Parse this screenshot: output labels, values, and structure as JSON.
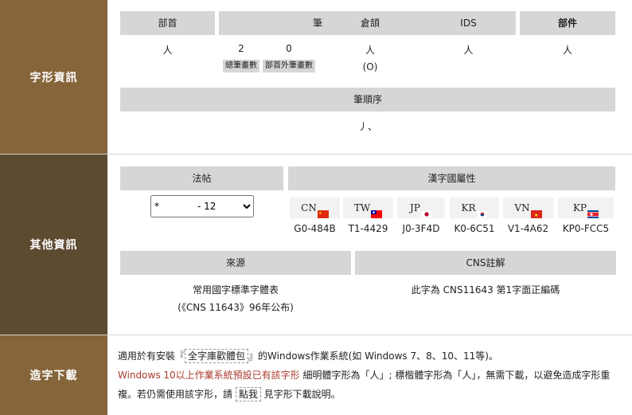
{
  "glyph_info": {
    "side_label": "字形資訊",
    "headers": {
      "radical": "部首",
      "strokes": "筆畫",
      "cangjie": "倉頡",
      "ids": "IDS",
      "component": "部件"
    },
    "radical_value": "人",
    "total_strokes": "2",
    "extra_strokes": "0",
    "total_strokes_label": "總筆畫數",
    "extra_strokes_label": "部首外筆畫數",
    "cangjie_value": "人",
    "cangjie_code": "(O)",
    "ids_value": "人",
    "component_value": "人",
    "stroke_order_header": "筆順序",
    "stroke_order_value": "丿、"
  },
  "other_info": {
    "side_label": "其他資訊",
    "calligraphy_header": "法帖",
    "calligraphy_select": {
      "selected": "*　　　　- 12",
      "options": [
        "*　　　　- 12"
      ]
    },
    "attribution_header": "漢字國屬性",
    "countries": [
      {
        "label": "CN",
        "flag": "cn",
        "code": "G0-484B"
      },
      {
        "label": "TW",
        "flag": "tw",
        "code": "T1-4429"
      },
      {
        "label": "JP",
        "flag": "jp",
        "code": "J0-3F4D"
      },
      {
        "label": "KR",
        "flag": "kr",
        "code": "K0-6C51"
      },
      {
        "label": "VN",
        "flag": "vn",
        "code": "V1-4A62"
      },
      {
        "label": "KP",
        "flag": "kp",
        "code": "KP0-FCC5"
      }
    ],
    "source_header": "來源",
    "source_line1": "常用國字標準字體表",
    "source_line2": "(《CNS 11643》96年公布)",
    "cns_header": "CNS註解",
    "cns_value": "此字為 CNS11643 第1字面正編碼"
  },
  "download": {
    "side_label": "造字下載",
    "line1_pre": "適用於有安裝『",
    "font_link": "全字庫歡體包",
    "line1_post": "』的Windows作業系統(如 Windows 7、8、10、11等)。",
    "red_text": "Windows 10以上作業系統預設已有該字形",
    "line2_rest": " 細明體字形為「人」; 標楷體字形為「人」，無需下載，以避免造成字形重複。若仍需使用該字形，請 ",
    "click_here": "點我",
    "line2_end": " 見字形下載說明。"
  },
  "colors": {
    "side_brown": "#86653b",
    "side_dark": "#5c4a31",
    "header_gray": "#d6d6d6",
    "red_text": "#a83a2e"
  }
}
